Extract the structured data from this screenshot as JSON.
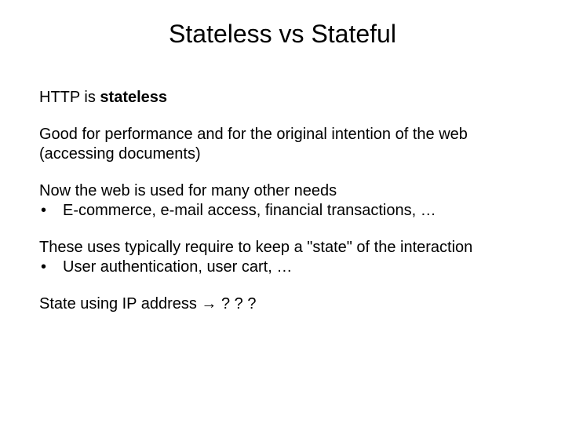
{
  "title": "Stateless vs Stateful",
  "p1_prefix": "HTTP is ",
  "p1_bold": "stateless",
  "p2": "Good for performance and for the original intention of the web (accessing documents)",
  "p3_line1": "Now the web is used for many other needs",
  "p3_bullet": "E-commerce, e-mail access, financial transactions, …",
  "p4_line1": "These uses typically require to keep a \"state\" of the interaction",
  "p4_bullet": "User authentication, user cart, …",
  "p5": "State using IP address → ? ? ?",
  "bullet_char": "•"
}
